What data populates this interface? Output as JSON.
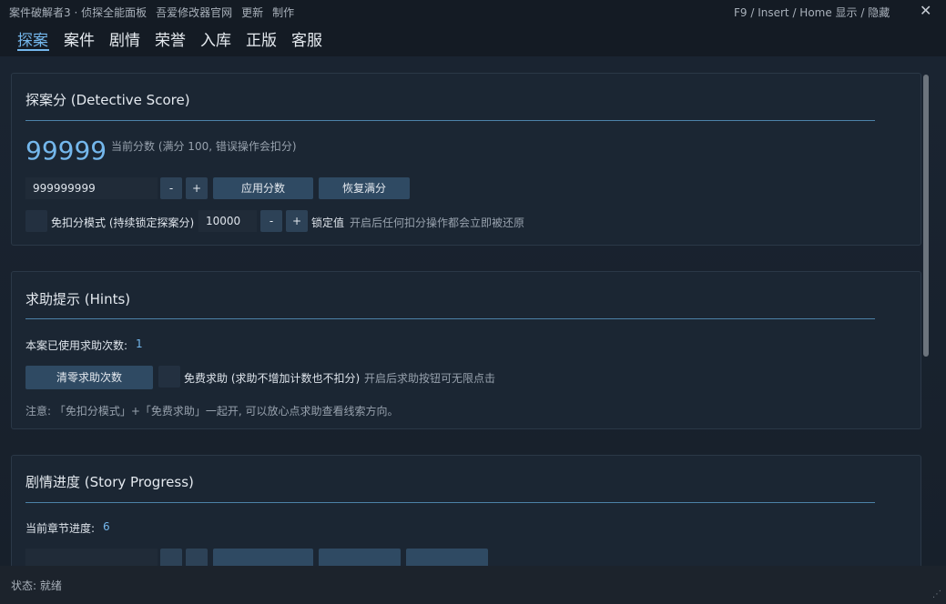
{
  "titlebar": {
    "items": [
      "案件破解者3 · 侦探全能面板",
      "吾爱修改器官网",
      "更新",
      "制作"
    ],
    "hotkey_hint": "F9 / Insert / Home  显示 / 隐藏",
    "close_glyph": "✕"
  },
  "tabs": [
    {
      "label": "探案",
      "active": true
    },
    {
      "label": "案件",
      "active": false
    },
    {
      "label": "剧情",
      "active": false
    },
    {
      "label": "荣誉",
      "active": false
    },
    {
      "label": "入库",
      "active": false
    },
    {
      "label": "正版",
      "active": false
    },
    {
      "label": "客服",
      "active": false
    }
  ],
  "detective": {
    "title": "探案分 (Detective Score)",
    "score": "99999",
    "score_note": "当前分数 (满分 100, 错误操作会扣分)",
    "input_value": "999999999",
    "minus_label": "-",
    "plus_label": "+",
    "apply_label": "应用分数",
    "restore_label": "恢复满分",
    "no_deduct_label": "免扣分模式 (持续锁定探案分)",
    "lock_input_value": "10000",
    "lock_label": "锁定值",
    "lock_hint": "开启后任何扣分操作都会立即被还原"
  },
  "hints": {
    "title": "求助提示 (Hints)",
    "used_label": "本案已使用求助次数:",
    "used_count": "1",
    "clear_label": "清零求助次数",
    "free_label": "免费求助 (求助不增加计数也不扣分)",
    "free_hint": "开启后求助按钮可无限点击",
    "note": "注意: 「免扣分模式」+「免费求助」一起开, 可以放心点求助查看线索方向。"
  },
  "story": {
    "title": "剧情进度 (Story Progress)",
    "chapter_label": "当前章节进度:",
    "chapter_value": "6"
  },
  "status": {
    "text": "状态: 就绪"
  }
}
